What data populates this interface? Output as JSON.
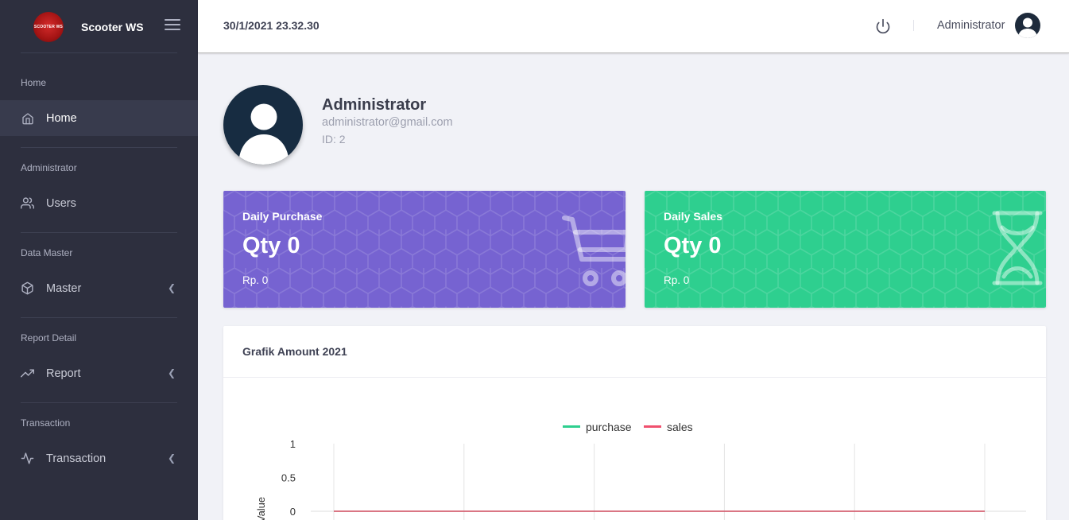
{
  "sidebar": {
    "brand_logo_text": "SCOOTER WS",
    "brand_name": "Scooter WS",
    "sections": [
      {
        "label": "Home",
        "item": "Home",
        "icon": "home-icon",
        "active": true,
        "has_caret": false
      },
      {
        "label": "Administrator",
        "item": "Users",
        "icon": "users-icon",
        "active": false,
        "has_caret": false
      },
      {
        "label": "Data Master",
        "item": "Master",
        "icon": "box-icon",
        "active": false,
        "has_caret": true
      },
      {
        "label": "Report Detail",
        "item": "Report",
        "icon": "trending-up-icon",
        "active": false,
        "has_caret": true
      },
      {
        "label": "Transaction",
        "item": "Transaction",
        "icon": "activity-icon",
        "active": false,
        "has_caret": true
      }
    ]
  },
  "topbar": {
    "datetime": "30/1/2021 23.32.30",
    "user_name": "Administrator"
  },
  "profile": {
    "name": "Administrator",
    "email": "administrator@gmail.com",
    "id_text": "ID: 2"
  },
  "cards": {
    "purchase": {
      "title": "Daily Purchase",
      "qty": "Qty 0",
      "amount": "Rp. 0",
      "color": "#7663d1",
      "icon": "cart-icon"
    },
    "sales": {
      "title": "Daily Sales",
      "qty": "Qty 0",
      "amount": "Rp. 0",
      "color": "#2ecf8f",
      "icon": "hourglass-icon"
    }
  },
  "chart_panel": {
    "title": "Grafik Amount 2021"
  },
  "chart_data": {
    "type": "line",
    "title": "",
    "ylabel": "Value",
    "xlabel": "",
    "ylim": [
      0,
      1
    ],
    "yticks": [
      "1",
      "0.5",
      "0"
    ],
    "legend_position": "top",
    "grid": true,
    "series": [
      {
        "name": "purchase",
        "color": "#2ecf8f",
        "values": [
          0,
          0,
          0,
          0,
          0,
          0
        ]
      },
      {
        "name": "sales",
        "color": "#f0506e",
        "values": [
          0,
          0,
          0,
          0,
          0,
          0
        ]
      }
    ]
  }
}
